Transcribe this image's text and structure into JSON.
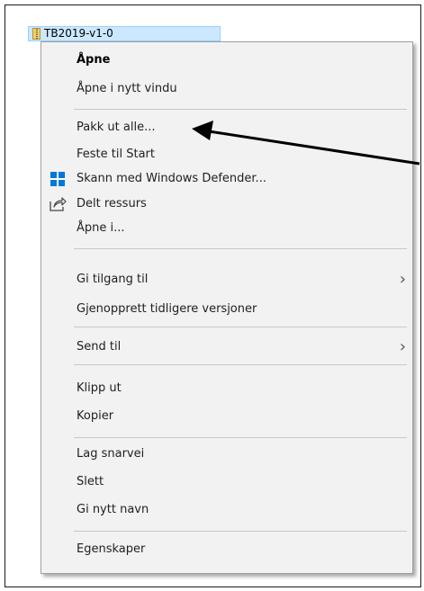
{
  "file": {
    "name": "TB2019-v1-0",
    "icon": "zip-folder-icon"
  },
  "menu": {
    "open": "Åpne",
    "open_new_window": "Åpne i nytt vindu",
    "extract_all": "Pakk ut alle...",
    "pin_start": "Feste til Start",
    "scan_defender": "Skann med Windows Defender...",
    "share": "Delt ressurs",
    "open_with": "Åpne i...",
    "give_access": "Gi tilgang til",
    "restore_versions": "Gjenopprett tidligere versjoner",
    "send_to": "Send til",
    "cut": "Klipp ut",
    "copy": "Kopier",
    "create_shortcut": "Lag snarvei",
    "delete": "Slett",
    "rename": "Gi nytt navn",
    "properties": "Egenskaper",
    "submenu_glyph": "›"
  },
  "colors": {
    "selection_bg": "#cce8ff",
    "menu_bg": "#f2f2f2",
    "defender_blue": "#0078d7",
    "annotation_arrow": "#000000"
  }
}
